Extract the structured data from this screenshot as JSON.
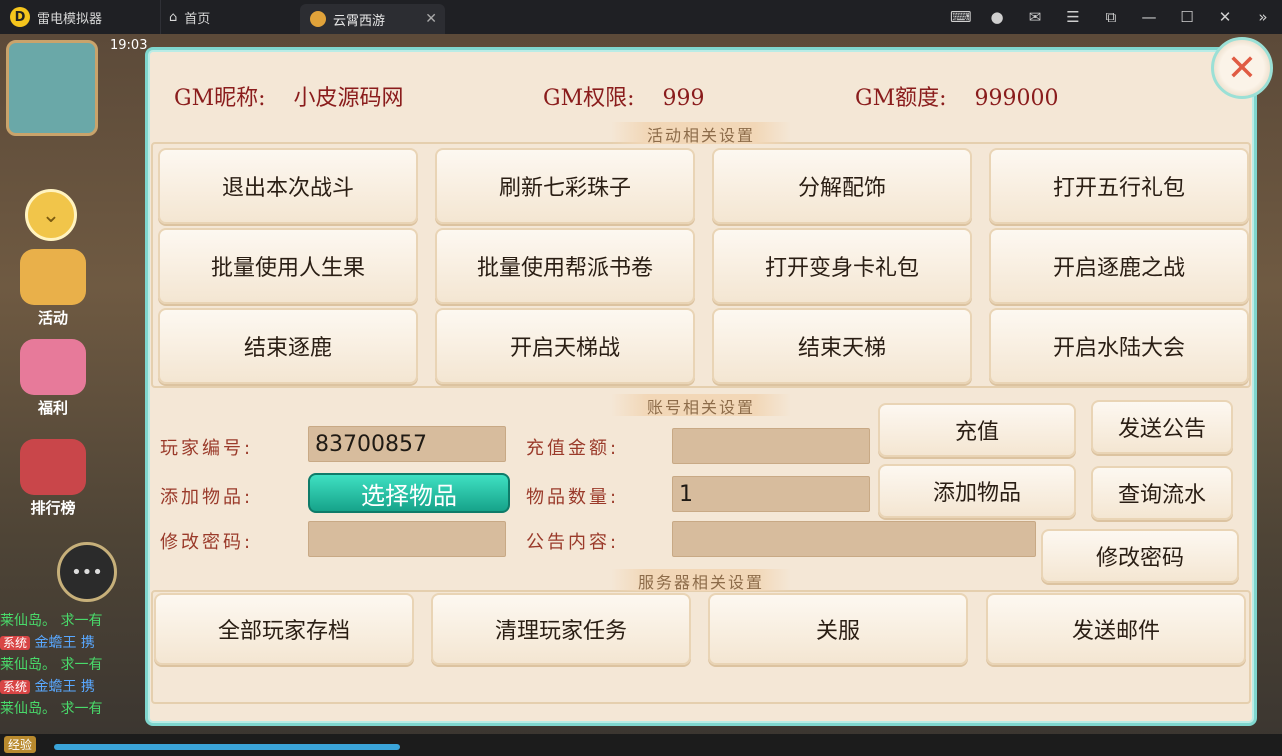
{
  "titlebar": {
    "app_name": "雷电模拟器",
    "home_tab": "首页",
    "active_tab": "云霄西游",
    "window_controls": [
      "gamepad-icon",
      "user-icon",
      "mail-icon",
      "menu-icon",
      "popout-icon",
      "minimize-icon",
      "maximize-icon",
      "close-icon",
      "collapse-icon"
    ]
  },
  "game_bg": {
    "time": "19:03",
    "side_items": [
      "活动",
      "福利",
      "排行榜"
    ],
    "chat_lines": [
      {
        "tag": "",
        "speaker": "莱仙岛。",
        "text": "求一有"
      },
      {
        "tag": "系统",
        "speaker": "金蟾王",
        "text": "携"
      },
      {
        "tag": "",
        "speaker": "莱仙岛。",
        "text": "求一有"
      },
      {
        "tag": "系统",
        "speaker": "金蟾王",
        "text": "携"
      },
      {
        "tag": "",
        "speaker": "莱仙岛。",
        "text": "求一有"
      }
    ],
    "exp_label": "经验"
  },
  "gm_header": {
    "nickname_label": "GM昵称:",
    "nickname_value": "小皮源码网",
    "permission_label": "GM权限:",
    "permission_value": "999",
    "quota_label": "GM额度:",
    "quota_value": "999000"
  },
  "sections": {
    "activity": "活动相关设置",
    "account": "账号相关设置",
    "server": "服务器相关设置"
  },
  "activity_buttons": [
    "退出本次战斗",
    "刷新七彩珠子",
    "分解配饰",
    "打开五行礼包",
    "批量使用人生果",
    "批量使用帮派书卷",
    "打开变身卡礼包",
    "开启逐鹿之战",
    "结束逐鹿",
    "开启天梯战",
    "结束天梯",
    "开启水陆大会"
  ],
  "account": {
    "player_id_label": "玩家编号:",
    "player_id_value": "83700857",
    "recharge_amount_label": "充值金额:",
    "recharge_amount_value": "",
    "add_item_label": "添加物品:",
    "select_item_button": "选择物品",
    "item_count_label": "物品数量:",
    "item_count_value": "1",
    "change_password_label": "修改密码:",
    "change_password_value": "",
    "announcement_label": "公告内容:",
    "announcement_value": "",
    "recharge_button": "充值",
    "send_announcement_button": "发送公告",
    "add_item_button": "添加物品",
    "query_flow_button": "查询流水",
    "change_password_button": "修改密码"
  },
  "server_buttons": [
    "全部玩家存档",
    "清理玩家任务",
    "关服",
    "发送邮件"
  ],
  "colors": {
    "panel_bg": "#f4e7d6",
    "panel_border": "#7fd6ce",
    "gm_text": "#8a1c1c",
    "select_button": "#16a38a"
  }
}
